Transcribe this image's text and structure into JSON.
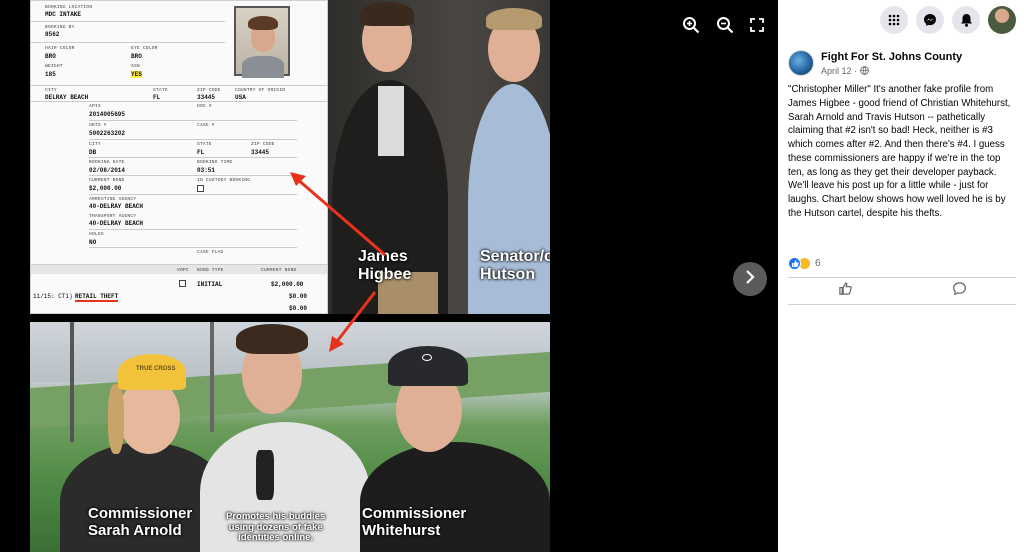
{
  "record": {
    "booking_location_label": "BOOKING LOCATION",
    "booking_location": "MDC INTAKE",
    "booking_by_label": "BOOKING BY",
    "booking_by": "8562",
    "hair_label": "HAIR COLOR",
    "hair": "BRO",
    "eye_label": "EYE COLOR",
    "eye": "BRO",
    "weight_label": "WEIGHT",
    "weight": "185",
    "ssn_label": "SSN",
    "ssn": "YES",
    "city_label": "CITY",
    "city": "DELRAY BEACH",
    "state_label": "STATE",
    "state": "FL",
    "zip_label": "ZIP CODE",
    "zip": "33445",
    "country_label": "COUNTRY OF ORIGIN",
    "country": "USA",
    "apis_label": "APIS",
    "apis": "2014005695",
    "doc_label": "DOC #",
    "obts_label": "OBTS #",
    "obts": "5002263202",
    "case_label": "CASE #",
    "city2": "DB",
    "state2": "FL",
    "zip2": "33445",
    "booking_date_label": "BOOKING DATE",
    "booking_date": "02/08/2014",
    "booking_time_label": "BOOKING TIME",
    "booking_time": "03:51",
    "bond_label": "CURRENT BOND",
    "bond": "$2,000.00",
    "custody_label": "IN CUSTODY BOOKING",
    "arresting_label": "ARRESTING AGENCY",
    "arresting": "40-DELRAY BEACH",
    "transport_label": "TRANSPORT AGENCY",
    "transport": "40-DELRAY BEACH",
    "holds_label": "HOLDS",
    "holds": "NO",
    "case_flag_label": "CASE FLAG",
    "vopc_label": "VOPC",
    "bond_type_label": "BOND TYPE",
    "current_bond_label": "CURRENT BOND",
    "bond_type": "INITIAL",
    "bond_amt1": "$2,000.00",
    "bond_amt2": "$0.00",
    "bond_amt3": "$0.00",
    "charge_prefix": "11/15: CT1)",
    "charge": "RETAIL THEFT"
  },
  "overlays": {
    "james": "James\nHigbee",
    "senator": "Senator/c\nHutson",
    "sarah": "Commissioner\nSarah Arnold",
    "promotes": "Promotes his buddies\nusing dozens of fake\nidentities online.",
    "whitehurst": "Commissioner\nWhitehurst"
  },
  "cap_text": "TRUE CROSS",
  "post": {
    "page_name": "Fight For St. Johns County",
    "date": "April 12 ·",
    "text": "\"Christopher Miller\" It's another fake profile from James Higbee - good friend of Christian Whitehurst, Sarah Arnold and Travis Hutson -- pathetically claiming that #2 isn't so bad! Heck, neither is #3 which comes after #2. And then there's #4. I guess these commissioners are happy if we're in the top ten, as long as they get their developer payback. We'll leave his post up for a little while - just for laughs. Chart below shows how well loved he is by the Hutson cartel, despite his thefts.",
    "reaction_count": "6"
  },
  "icons": [
    "zoom-in-icon",
    "zoom-out-icon",
    "fullscreen-icon",
    "chevron-right-icon",
    "menu-grid-icon",
    "messenger-icon",
    "bell-icon",
    "globe-icon",
    "like-icon",
    "comment-icon"
  ],
  "colors": {
    "arrow": "#e8321c",
    "highlight": "#ffef3a",
    "like_blue": "#1877f2",
    "haha_yellow": "#f7b928"
  }
}
